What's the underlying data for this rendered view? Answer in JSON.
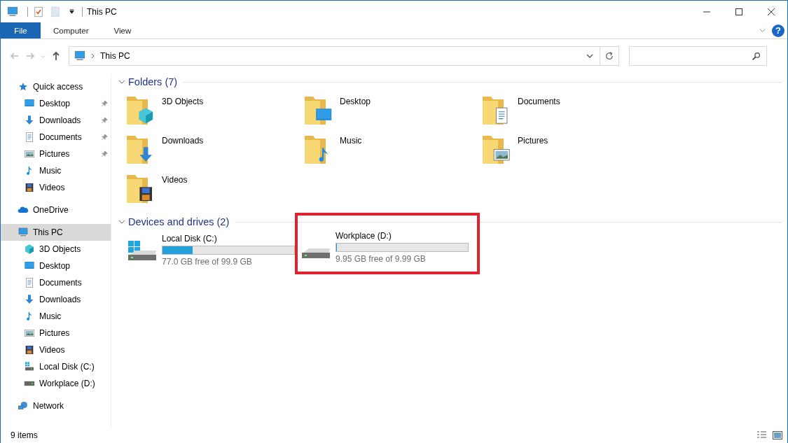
{
  "window": {
    "title": "This PC"
  },
  "ribbon_tabs": [
    {
      "label": "File",
      "kind": "file"
    },
    {
      "label": "Computer",
      "kind": "tab"
    },
    {
      "label": "View",
      "kind": "tab"
    }
  ],
  "help_button": {
    "label": "?"
  },
  "address": {
    "path": "This PC"
  },
  "sidebar": {
    "items": [
      {
        "label": "Quick access",
        "kind": "star",
        "selected": false,
        "children": [
          {
            "label": "Desktop",
            "kind": "desktop",
            "pinned": true,
            "selected": false
          },
          {
            "label": "Downloads",
            "kind": "downloads",
            "pinned": true,
            "selected": false
          },
          {
            "label": "Documents",
            "kind": "documents",
            "pinned": true,
            "selected": false
          },
          {
            "label": "Pictures",
            "kind": "pictures",
            "pinned": true,
            "selected": false
          },
          {
            "label": "Music",
            "kind": "music",
            "pinned": false,
            "selected": false
          },
          {
            "label": "Videos",
            "kind": "videos",
            "pinned": false,
            "selected": false
          }
        ]
      },
      {
        "label": "OneDrive",
        "kind": "cloud",
        "selected": false
      },
      {
        "label": "This PC",
        "kind": "pc",
        "selected": true,
        "children": [
          {
            "label": "3D Objects",
            "kind": "objects",
            "pinned": false,
            "selected": false
          },
          {
            "label": "Desktop",
            "kind": "desktop",
            "pinned": false,
            "selected": false
          },
          {
            "label": "Documents",
            "kind": "documents",
            "pinned": false,
            "selected": false
          },
          {
            "label": "Downloads",
            "kind": "downloads",
            "pinned": false,
            "selected": false
          },
          {
            "label": "Music",
            "kind": "music",
            "pinned": false,
            "selected": false
          },
          {
            "label": "Pictures",
            "kind": "pictures",
            "pinned": false,
            "selected": false
          },
          {
            "label": "Videos",
            "kind": "videos",
            "pinned": false,
            "selected": false
          },
          {
            "label": "Local Disk (C:)",
            "kind": "windrive",
            "pinned": false,
            "selected": false
          },
          {
            "label": "Workplace (D:)",
            "kind": "drive",
            "pinned": false,
            "selected": false
          }
        ]
      },
      {
        "label": "Network",
        "kind": "network",
        "selected": false
      }
    ]
  },
  "folders": {
    "title": "Folders (7)",
    "expanded": true,
    "items": [
      {
        "label": "3D Objects",
        "kind": "objects"
      },
      {
        "label": "Desktop",
        "kind": "desktop"
      },
      {
        "label": "Documents",
        "kind": "documents"
      },
      {
        "label": "Downloads",
        "kind": "downloads"
      },
      {
        "label": "Music",
        "kind": "music"
      },
      {
        "label": "Pictures",
        "kind": "pictures"
      },
      {
        "label": "Videos",
        "kind": "videos"
      }
    ]
  },
  "drives": {
    "title": "Devices and drives (2)",
    "expanded": true,
    "items": [
      {
        "label": "Local Disk (C:)",
        "kind": "windrive",
        "level": 0.23,
        "reading": "77.0 GB free of 99.9 GB",
        "highlighted": false
      },
      {
        "label": "Workplace (D:)",
        "kind": "drive",
        "level": 0.004,
        "reading": "9.95 GB free of 9.99 GB",
        "highlighted": true
      }
    ]
  },
  "status_bar": {
    "text": "9 items"
  }
}
